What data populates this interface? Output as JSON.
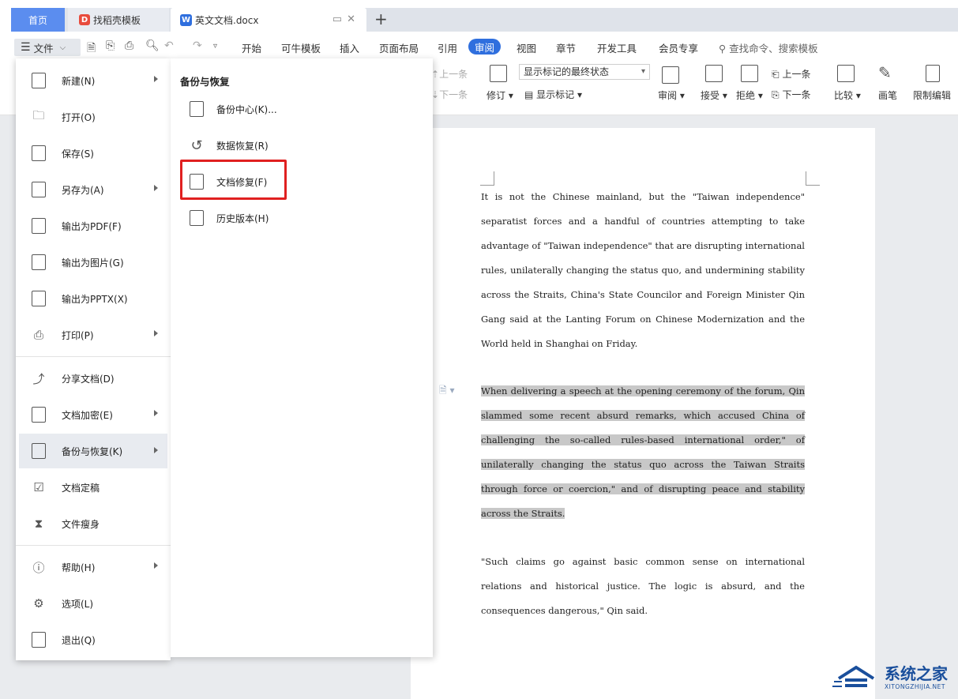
{
  "tabs": {
    "home": "首页",
    "template": "找稻壳模板",
    "document": "英文文档.docx"
  },
  "menubar": {
    "file": "文件",
    "items": [
      "开始",
      "可牛模板",
      "插入",
      "页面布局",
      "引用",
      "审阅",
      "视图",
      "章节",
      "开发工具",
      "会员专享"
    ],
    "active": "审阅",
    "search": "查找命令、搜索模板"
  },
  "ribbon": {
    "prev": "上一条",
    "next": "下一条",
    "track": "修订",
    "markup_state": "显示标记的最终状态",
    "show_markup": "显示标记",
    "review": "审阅",
    "accept": "接受",
    "reject": "拒绝",
    "prev2": "上一条",
    "next2": "下一条",
    "compare": "比较",
    "pen": "画笔",
    "restrict": "限制编辑"
  },
  "file_menu": {
    "items": [
      {
        "label": "新建(N)",
        "icon": "new-icon",
        "arrow": true
      },
      {
        "label": "打开(O)",
        "icon": "folder-icon",
        "arrow": false
      },
      {
        "label": "保存(S)",
        "icon": "save-icon",
        "arrow": false
      },
      {
        "label": "另存为(A)",
        "icon": "save-as-icon",
        "arrow": true
      },
      {
        "label": "输出为PDF(F)",
        "icon": "pdf-icon",
        "arrow": false
      },
      {
        "label": "输出为图片(G)",
        "icon": "image-icon",
        "arrow": false
      },
      {
        "label": "输出为PPTX(X)",
        "icon": "pptx-icon",
        "arrow": false
      },
      {
        "label": "打印(P)",
        "icon": "print-icon",
        "arrow": true
      },
      {
        "label": "分享文档(D)",
        "icon": "share-icon",
        "arrow": false
      },
      {
        "label": "文档加密(E)",
        "icon": "encrypt-icon",
        "arrow": true
      },
      {
        "label": "备份与恢复(K)",
        "icon": "backup-icon",
        "arrow": true
      },
      {
        "label": "文档定稿",
        "icon": "finalize-icon",
        "arrow": false
      },
      {
        "label": "文件瘦身",
        "icon": "slim-icon",
        "arrow": false
      },
      {
        "label": "帮助(H)",
        "icon": "help-icon",
        "arrow": true
      },
      {
        "label": "选项(L)",
        "icon": "options-icon",
        "arrow": false
      },
      {
        "label": "退出(Q)",
        "icon": "exit-icon",
        "arrow": false
      }
    ]
  },
  "submenu": {
    "title": "备份与恢复",
    "items": [
      {
        "label": "备份中心(K)...",
        "icon": "backup-center-icon"
      },
      {
        "label": "数据恢复(R)",
        "icon": "data-recovery-icon"
      },
      {
        "label": "文档修复(F)",
        "icon": "doc-repair-icon"
      },
      {
        "label": "历史版本(H)",
        "icon": "history-icon"
      }
    ],
    "highlighted": "文档修复(F)"
  },
  "document": {
    "p1": "It is not the Chinese mainland, but the \"Taiwan independence\" separatist forces and a handful of countries attempting to take advantage of \"Taiwan independence\" that are disrupting international rules, unilaterally changing the status quo, and undermining stability across the Straits, China's State Councilor and Foreign Minister Qin Gang said at the Lanting Forum on Chinese Modernization and the World held in Shanghai on Friday.",
    "p2": "When delivering a speech at the opening ceremony of the forum, Qin slammed some recent absurd remarks, which accused China of challenging the so-called rules-based international order,\" of unilaterally changing the status quo across the Taiwan Straits through force or coercion,\" and of disrupting peace and stability across the Straits.",
    "p3": "\"Such claims go against basic common sense on international relations and historical justice. The logic is absurd, and the consequences dangerous,\" Qin said."
  },
  "watermark": {
    "title": "系统之家",
    "sub": "XITONGZHIJIA.NET"
  },
  "colors": {
    "accent": "#2f6fde",
    "highlight_border": "#e02020",
    "selection": "#c8c8c8"
  }
}
